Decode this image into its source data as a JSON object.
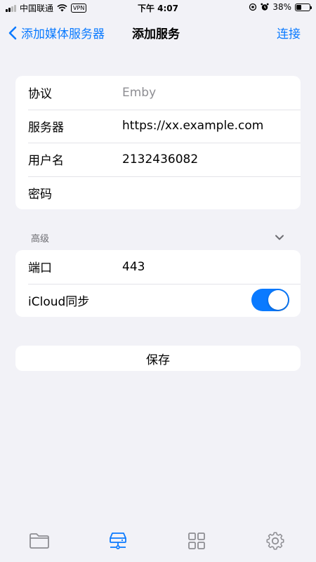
{
  "status_bar": {
    "carrier": "中国联通",
    "vpn_label": "VPN",
    "time": "下午 4:07",
    "battery_percent": "38%",
    "battery_level": 0.38
  },
  "nav": {
    "back_label": "添加媒体服务器",
    "title": "添加服务",
    "action_label": "连接"
  },
  "server_group": {
    "rows": [
      {
        "label": "协议",
        "value": "Emby",
        "is_placeholder": true
      },
      {
        "label": "服务器",
        "value": "https://xx.example.com"
      },
      {
        "label": "用户名",
        "value": "2132436082"
      },
      {
        "label": "密码",
        "value": ""
      }
    ]
  },
  "advanced": {
    "header": "高级",
    "rows": [
      {
        "label": "端口",
        "value": "443"
      },
      {
        "label": "iCloud同步",
        "toggle_on": true
      }
    ]
  },
  "save_label": "保存",
  "tab_bar": {
    "active_tab": "servers",
    "active_color": "#0a7aff",
    "inactive_color": "#8e8e93",
    "tabs": [
      {
        "icon": "folder-icon"
      },
      {
        "icon": "server-icon"
      },
      {
        "icon": "grid-icon"
      },
      {
        "icon": "gear-icon"
      }
    ]
  },
  "colors": {
    "accent": "#0a7aff",
    "background": "#f2f2f7",
    "card": "#ffffff"
  }
}
